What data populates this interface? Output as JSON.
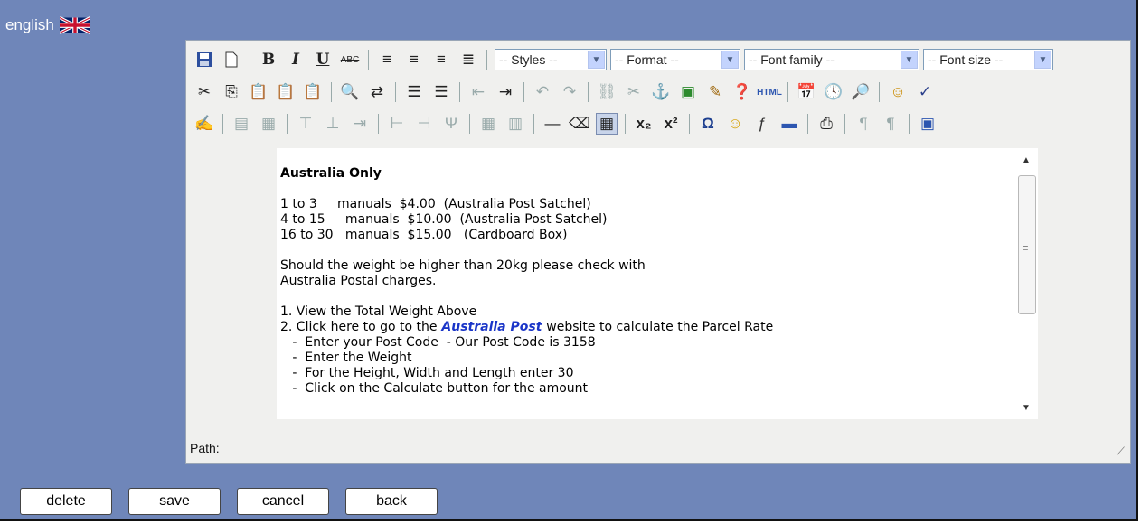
{
  "language": {
    "label": "english",
    "flag_icon": "uk-flag-icon"
  },
  "toolbar": {
    "row1_groups": [
      [
        "save-icon",
        "new-document-icon"
      ],
      [
        "bold-icon",
        "italic-icon",
        "underline-icon",
        "strikethrough-icon"
      ],
      [
        "align-left-icon",
        "align-center-icon",
        "align-right-icon",
        "align-justify-icon"
      ]
    ],
    "row1_labels": {
      "bold": "B",
      "italic": "I",
      "underline": "U",
      "strike": "ABC"
    },
    "selects": {
      "styles": "-- Styles --",
      "format": "-- Format --",
      "font_family": "-- Font family --",
      "font_size": "-- Font size --"
    },
    "row3_labels": {
      "html": "HTML"
    }
  },
  "content": {
    "heading": "Australia Only",
    "rates": [
      "1 to 3     manuals  $4.00  (Australia Post Satchel)",
      "4 to 15     manuals  $10.00  (Australia Post Satchel)",
      "16 to 30   manuals  $15.00   (Cardboard Box)"
    ],
    "weight_note_1": "Should the weight be higher than 20kg please check with",
    "weight_note_2": "Australia Postal charges.",
    "step1": "1. View the Total Weight Above",
    "step2_prefix": "2. Click here to go to the",
    "step2_link": " Australia Post ",
    "step2_suffix": "website to calculate the Parcel Rate",
    "substeps": [
      "   -  Enter your Post Code  - Our Post Code is 3158",
      "   -  Enter the Weight",
      "   -  For the Height, Width and Length enter 30",
      "   -  Click on the Calculate button for the amount"
    ]
  },
  "path_label": "Path:",
  "buttons": {
    "delete": "delete",
    "save": "save",
    "cancel": "cancel",
    "back": "back"
  },
  "colors": {
    "background": "#6f86b9",
    "link": "#1a35c8"
  }
}
